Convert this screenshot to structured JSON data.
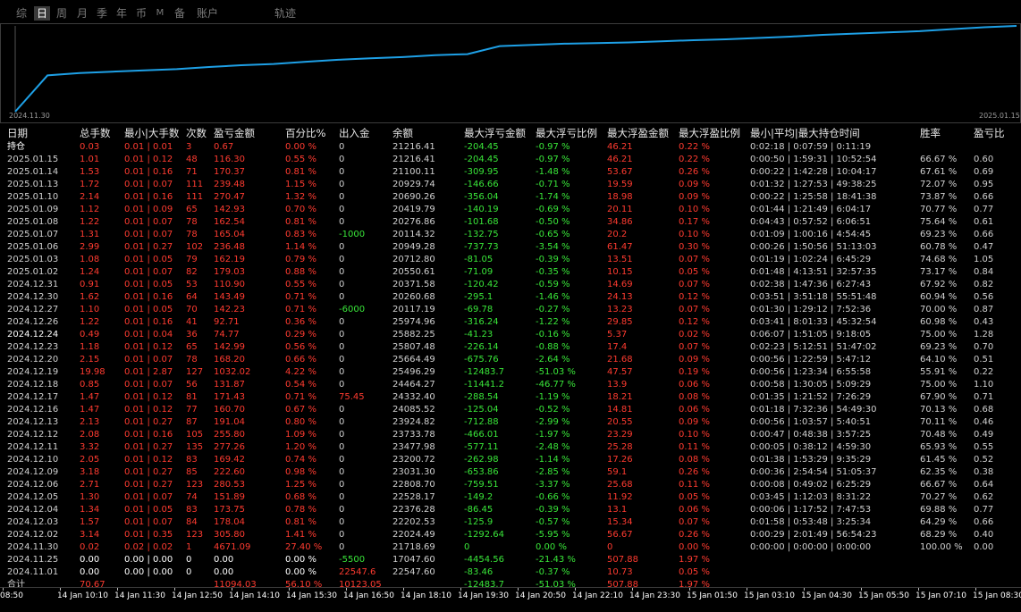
{
  "tabs": [
    {
      "label": "综",
      "active": false
    },
    {
      "label": "日",
      "active": true
    },
    {
      "label": "周",
      "active": false
    },
    {
      "label": "月",
      "active": false
    },
    {
      "label": "季",
      "active": false
    },
    {
      "label": "年",
      "active": false
    },
    {
      "label": "币",
      "active": false
    },
    {
      "label": "M",
      "active": false
    },
    {
      "label": "备",
      "active": false
    },
    {
      "label": "账户",
      "active": false
    },
    {
      "label": "轨迹",
      "active": false
    }
  ],
  "chart": {
    "start_label": "2024.11.30",
    "end_label": "2025.01.15",
    "line_color": "#1ea0e6",
    "dates": [
      "2024.11.30",
      "2024.12.02",
      "2024.12.03",
      "2024.12.04",
      "2024.12.05",
      "2024.12.06",
      "2024.12.09",
      "2024.12.10",
      "2024.12.11",
      "2024.12.12",
      "2024.12.13",
      "2024.12.16",
      "2024.12.17",
      "2024.12.18",
      "2024.12.19",
      "2024.12.20",
      "2024.12.23",
      "2024.12.24",
      "2024.12.26",
      "2024.12.27",
      "2024.12.30",
      "2024.12.31",
      "2025.01.02",
      "2025.01.03",
      "2025.01.06",
      "2025.01.07",
      "2025.01.08",
      "2025.01.09",
      "2025.01.10",
      "2025.01.13",
      "2025.01.14",
      "2025.01.15"
    ],
    "values": [
      17047.6,
      21718.69,
      22024.49,
      22202.53,
      22376.28,
      22528.17,
      22808.7,
      23031.3,
      23200.72,
      23477.98,
      23733.78,
      23924.82,
      24085.52,
      24332.4,
      24464.27,
      25496.29,
      25664.49,
      25807.48,
      25882.25,
      25974.96,
      26117.19,
      26260.68,
      26371.58,
      26550.61,
      26712.8,
      26949.28,
      27114.32,
      27276.86,
      27419.79,
      27690.26,
      27929.74,
      28100.11
    ]
  },
  "table": {
    "headers": [
      "日期",
      "总手数",
      "最小|大手数",
      "次数",
      "盈亏金额",
      "百分比%",
      "出入金",
      "余额",
      "最大浮亏金额",
      "最大浮亏比例",
      "最大浮盈金额",
      "最大浮盈比例",
      "最小|平均|最大持仓时间",
      "胜率",
      "盈亏比"
    ],
    "rows": [
      [
        "持仓",
        "0.03",
        "0.01 | 0.01",
        "3",
        "0.67",
        "0.00 %",
        "0",
        "21216.41",
        "-204.45",
        "-0.97 %",
        "46.21",
        "0.22 %",
        "0:02:18 | 0:07:59 | 0:11:19",
        "",
        ""
      ],
      [
        "2025.01.15",
        "1.01",
        "0.01 | 0.12",
        "48",
        "116.30",
        "0.55 %",
        "0",
        "21216.41",
        "-204.45",
        "-0.97 %",
        "46.21",
        "0.22 %",
        "0:00:50 | 1:59:31 | 10:52:54",
        "66.67 %",
        "0.60"
      ],
      [
        "2025.01.14",
        "1.53",
        "0.01 | 0.16",
        "71",
        "170.37",
        "0.81 %",
        "0",
        "21100.11",
        "-309.95",
        "-1.48 %",
        "53.67",
        "0.26 %",
        "0:00:22 | 1:42:28 | 10:04:17",
        "67.61 %",
        "0.69"
      ],
      [
        "2025.01.13",
        "1.72",
        "0.01 | 0.07",
        "111",
        "239.48",
        "1.15 %",
        "0",
        "20929.74",
        "-146.66",
        "-0.71 %",
        "19.59",
        "0.09 %",
        "0:01:32 | 1:27:53 | 49:38:25",
        "72.07 %",
        "0.95"
      ],
      [
        "2025.01.10",
        "2.14",
        "0.01 | 0.16",
        "111",
        "270.47",
        "1.32 %",
        "0",
        "20690.26",
        "-356.04",
        "-1.74 %",
        "18.98",
        "0.09 %",
        "0:00:22 | 1:25:58 | 18:41:38",
        "73.87 %",
        "0.66"
      ],
      [
        "2025.01.09",
        "1.12",
        "0.01 | 0.09",
        "65",
        "142.93",
        "0.70 %",
        "0",
        "20419.79",
        "-140.19",
        "-0.69 %",
        "20.11",
        "0.10 %",
        "0:01:44 | 1:21:49 | 6:04:17",
        "70.77 %",
        "0.77"
      ],
      [
        "2025.01.08",
        "1.22",
        "0.01 | 0.07",
        "78",
        "162.54",
        "0.81 %",
        "0",
        "20276.86",
        "-101.68",
        "-0.50 %",
        "34.86",
        "0.17 %",
        "0:04:43 | 0:57:52 | 6:06:51",
        "75.64 %",
        "0.61"
      ],
      [
        "2025.01.07",
        "1.31",
        "0.01 | 0.07",
        "78",
        "165.04",
        "0.83 %",
        "-1000",
        "20114.32",
        "-132.75",
        "-0.65 %",
        "20.2",
        "0.10 %",
        "0:01:09 | 1:00:16 | 4:54:45",
        "69.23 %",
        "0.66"
      ],
      [
        "2025.01.06",
        "2.99",
        "0.01 | 0.27",
        "102",
        "236.48",
        "1.14 %",
        "0",
        "20949.28",
        "-737.73",
        "-3.54 %",
        "61.47",
        "0.30 %",
        "0:00:26 | 1:50:56 | 51:13:03",
        "60.78 %",
        "0.47"
      ],
      [
        "2025.01.03",
        "1.08",
        "0.01 | 0.05",
        "79",
        "162.19",
        "0.79 %",
        "0",
        "20712.80",
        "-81.05",
        "-0.39 %",
        "13.51",
        "0.07 %",
        "0:01:19 | 1:02:24 | 6:45:29",
        "74.68 %",
        "1.05"
      ],
      [
        "2025.01.02",
        "1.24",
        "0.01 | 0.07",
        "82",
        "179.03",
        "0.88 %",
        "0",
        "20550.61",
        "-71.09",
        "-0.35 %",
        "10.15",
        "0.05 %",
        "0:01:48 | 4:13:51 | 32:57:35",
        "73.17 %",
        "0.84"
      ],
      [
        "2024.12.31",
        "0.91",
        "0.01 | 0.05",
        "53",
        "110.90",
        "0.55 %",
        "0",
        "20371.58",
        "-120.42",
        "-0.59 %",
        "14.69",
        "0.07 %",
        "0:02:38 | 1:47:36 | 6:27:43",
        "67.92 %",
        "0.82"
      ],
      [
        "2024.12.30",
        "1.62",
        "0.01 | 0.16",
        "64",
        "143.49",
        "0.71 %",
        "0",
        "20260.68",
        "-295.1",
        "-1.46 %",
        "24.13",
        "0.12 %",
        "0:03:51 | 3:51:18 | 55:51:48",
        "60.94 %",
        "0.56"
      ],
      [
        "2024.12.27",
        "1.10",
        "0.01 | 0.05",
        "70",
        "142.23",
        "0.71 %",
        "-6000",
        "20117.19",
        "-69.78",
        "-0.27 %",
        "13.23",
        "0.07 %",
        "0:01:30 | 1:29:12 | 7:52:36",
        "70.00 %",
        "0.87"
      ],
      [
        "2024.12.26",
        "1.22",
        "0.01 | 0.16",
        "41",
        "92.71",
        "0.36 %",
        "0",
        "25974.96",
        "-316.24",
        "-1.22 %",
        "29.85",
        "0.12 %",
        "0:03:41 | 8:01:33 | 45:32:54",
        "60.98 %",
        "0.43"
      ],
      [
        "2024.12.24",
        "0.49",
        "0.01 | 0.04",
        "36",
        "74.77",
        "0.29 %",
        "0",
        "25882.25",
        "-41.23",
        "-0.16 %",
        "5.37",
        "0.02 %",
        "0:06:07 | 1:51:05 | 9:18:05",
        "75.00 %",
        "1.28"
      ],
      [
        "2024.12.23",
        "1.18",
        "0.01 | 0.12",
        "65",
        "142.99",
        "0.56 %",
        "0",
        "25807.48",
        "-226.14",
        "-0.88 %",
        "17.4",
        "0.07 %",
        "0:02:23 | 5:12:51 | 51:47:02",
        "69.23 %",
        "0.70"
      ],
      [
        "2024.12.20",
        "2.15",
        "0.01 | 0.07",
        "78",
        "168.20",
        "0.66 %",
        "0",
        "25664.49",
        "-675.76",
        "-2.64 %",
        "21.68",
        "0.09 %",
        "0:00:56 | 1:22:59 | 5:47:12",
        "64.10 %",
        "0.51"
      ],
      [
        "2024.12.19",
        "19.98",
        "0.01 | 2.87",
        "127",
        "1032.02",
        "4.22 %",
        "0",
        "25496.29",
        "-12483.7",
        "-51.03 %",
        "47.57",
        "0.19 %",
        "0:00:56 | 1:23:34 | 6:55:58",
        "55.91 %",
        "0.22"
      ],
      [
        "2024.12.18",
        "0.85",
        "0.01 | 0.07",
        "56",
        "131.87",
        "0.54 %",
        "0",
        "24464.27",
        "-11441.2",
        "-46.77 %",
        "13.9",
        "0.06 %",
        "0:00:58 | 1:30:05 | 5:09:29",
        "75.00 %",
        "1.10"
      ],
      [
        "2024.12.17",
        "1.47",
        "0.01 | 0.12",
        "81",
        "171.43",
        "0.71 %",
        "75.45",
        "24332.40",
        "-288.54",
        "-1.19 %",
        "18.21",
        "0.08 %",
        "0:01:35 | 1:21:52 | 7:26:29",
        "67.90 %",
        "0.71"
      ],
      [
        "2024.12.16",
        "1.47",
        "0.01 | 0.12",
        "77",
        "160.70",
        "0.67 %",
        "0",
        "24085.52",
        "-125.04",
        "-0.52 %",
        "14.81",
        "0.06 %",
        "0:01:18 | 7:32:36 | 54:49:30",
        "70.13 %",
        "0.68"
      ],
      [
        "2024.12.13",
        "2.13",
        "0.01 | 0.27",
        "87",
        "191.04",
        "0.80 %",
        "0",
        "23924.82",
        "-712.88",
        "-2.99 %",
        "20.55",
        "0.09 %",
        "0:00:56 | 1:03:57 | 5:40:51",
        "70.11 %",
        "0.46"
      ],
      [
        "2024.12.12",
        "2.08",
        "0.01 | 0.16",
        "105",
        "255.80",
        "1.09 %",
        "0",
        "23733.78",
        "-466.01",
        "-1.97 %",
        "23.29",
        "0.10 %",
        "0:00:47 | 0:48:38 | 3:57:25",
        "70.48 %",
        "0.49"
      ],
      [
        "2024.12.11",
        "3.32",
        "0.01 | 0.27",
        "135",
        "277.26",
        "1.20 %",
        "0",
        "23477.98",
        "-577.11",
        "-2.48 %",
        "25.28",
        "0.11 %",
        "0:00:05 | 0:38:12 | 4:59:30",
        "65.93 %",
        "0.55"
      ],
      [
        "2024.12.10",
        "2.05",
        "0.01 | 0.12",
        "83",
        "169.42",
        "0.74 %",
        "0",
        "23200.72",
        "-262.98",
        "-1.14 %",
        "17.26",
        "0.08 %",
        "0:01:38 | 1:53:29 | 9:35:29",
        "61.45 %",
        "0.52"
      ],
      [
        "2024.12.09",
        "3.18",
        "0.01 | 0.27",
        "85",
        "222.60",
        "0.98 %",
        "0",
        "23031.30",
        "-653.86",
        "-2.85 %",
        "59.1",
        "0.26 %",
        "0:00:36 | 2:54:54 | 51:05:37",
        "62.35 %",
        "0.38"
      ],
      [
        "2024.12.06",
        "2.71",
        "0.01 | 0.27",
        "123",
        "280.53",
        "1.25 %",
        "0",
        "22808.70",
        "-759.51",
        "-3.37 %",
        "25.68",
        "0.11 %",
        "0:00:08 | 0:49:02 | 6:25:29",
        "66.67 %",
        "0.64"
      ],
      [
        "2024.12.05",
        "1.30",
        "0.01 | 0.07",
        "74",
        "151.89",
        "0.68 %",
        "0",
        "22528.17",
        "-149.2",
        "-0.66 %",
        "11.92",
        "0.05 %",
        "0:03:45 | 1:12:03 | 8:31:22",
        "70.27 %",
        "0.62"
      ],
      [
        "2024.12.04",
        "1.34",
        "0.01 | 0.05",
        "83",
        "173.75",
        "0.78 %",
        "0",
        "22376.28",
        "-86.45",
        "-0.39 %",
        "13.1",
        "0.06 %",
        "0:00:06 | 1:17:52 | 7:47:53",
        "69.88 %",
        "0.77"
      ],
      [
        "2024.12.03",
        "1.57",
        "0.01 | 0.07",
        "84",
        "178.04",
        "0.81 %",
        "0",
        "22202.53",
        "-125.9",
        "-0.57 %",
        "15.34",
        "0.07 %",
        "0:01:58 | 0:53:48 | 3:25:34",
        "64.29 %",
        "0.66"
      ],
      [
        "2024.12.02",
        "3.14",
        "0.01 | 0.35",
        "123",
        "305.80",
        "1.41 %",
        "0",
        "22024.49",
        "-1292.64",
        "-5.95 %",
        "56.67",
        "0.26 %",
        "0:00:29 | 2:01:49 | 56:54:23",
        "68.29 %",
        "0.40"
      ],
      [
        "2024.11.30",
        "0.02",
        "0.02 | 0.02",
        "1",
        "4671.09",
        "27.40 %",
        "0",
        "21718.69",
        "0",
        "0.00 %",
        "0",
        "0.00 %",
        "0:00:00 | 0:00:00 | 0:00:00",
        "100.00 %",
        "0.00"
      ],
      [
        "2024.11.25",
        "0.00",
        "0.00 | 0.00",
        "0",
        "0.00",
        "0.00 %",
        "-5500",
        "17047.60",
        "-4454.56",
        "-21.43 %",
        "507.88",
        "1.97 %",
        "",
        "",
        ""
      ],
      [
        "2024.11.01",
        "0.00",
        "0.00 | 0.00",
        "0",
        "0.00",
        "0.00 %",
        "22547.6",
        "22547.60",
        "-83.46",
        "-0.37 %",
        "10.73",
        "0.05 %",
        "",
        "",
        ""
      ],
      [
        "合计",
        "70.67",
        "",
        "",
        "11094.03",
        "56.10 %",
        "10123.05",
        "",
        "-12483.7",
        "-51.03 %",
        "507.88",
        "1.97 %",
        "",
        "",
        ""
      ]
    ]
  },
  "timeline": [
    "08:50",
    "14 Jan 10:10",
    "14 Jan 11:30",
    "14 Jan 12:50",
    "14 Jan 14:10",
    "14 Jan 15:30",
    "14 Jan 16:50",
    "14 Jan 18:10",
    "14 Jan 19:30",
    "14 Jan 20:50",
    "14 Jan 22:10",
    "14 Jan 23:30",
    "15 Jan 01:50",
    "15 Jan 03:10",
    "15 Jan 04:30",
    "15 Jan 05:50",
    "15 Jan 07:10",
    "15 Jan 08:30",
    "15 Ja"
  ],
  "colors": {
    "profit": "#ff3b30",
    "loss": "#39e639",
    "neutral": "#d0d0d0",
    "background": "#000000"
  }
}
